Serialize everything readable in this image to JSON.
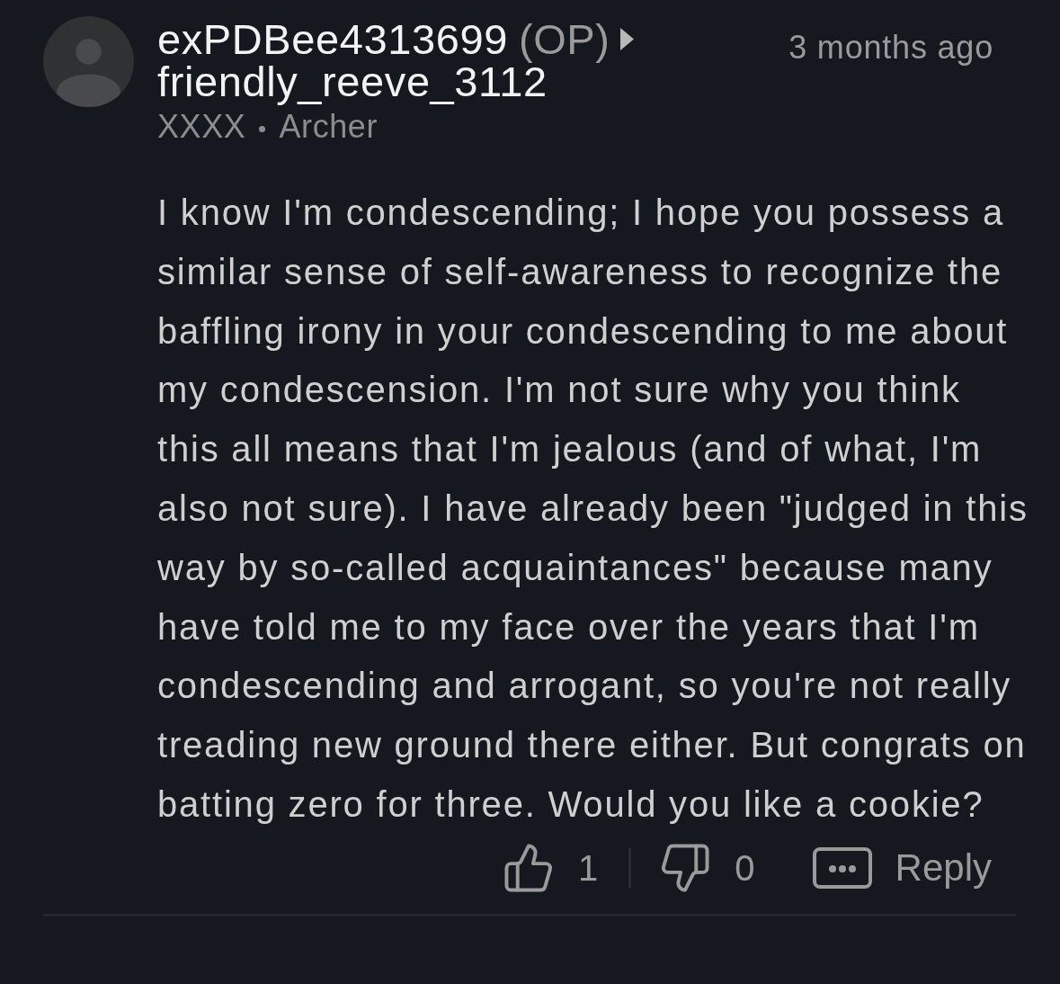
{
  "comment": {
    "author": {
      "username": "exPDBee4313699",
      "op_label": "(OP)",
      "reply_to": "friendly_reeve_3112"
    },
    "timestamp": "3 months ago",
    "meta": [
      "XXXX",
      "Archer"
    ],
    "body": "I know I'm condescending; I hope you possess a similar sense of self-awareness to recognize the baffling irony in your condescending to me about my condescension. I'm not sure why you think this all means that I'm jealous (and of what, I'm also not sure). I have already been \"judged in this way by so-called acquaintances\" because many have told me to my face over the years that I'm condescending and arrogant, so you're not really treading new ground there either. But congrats on batting zero for three. Would you like a cookie?",
    "actions": {
      "likes": "1",
      "dislikes": "0",
      "reply": "Reply"
    }
  }
}
